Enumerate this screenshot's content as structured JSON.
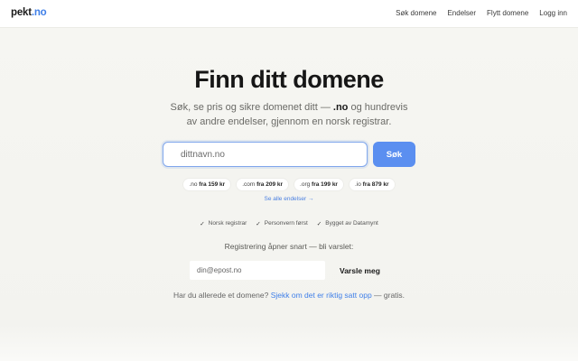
{
  "header": {
    "logo_name": "pekt",
    "logo_tld": ".no",
    "nav": [
      {
        "label": "Søk domene"
      },
      {
        "label": "Endelser"
      },
      {
        "label": "Flytt domene"
      },
      {
        "label": "Logg inn"
      }
    ]
  },
  "hero": {
    "title": "Finn ditt domene",
    "subtitle_line1_before": "Søk, se pris og sikre domenet ditt — ",
    "subtitle_line1_bold": ".no",
    "subtitle_line1_after": " og hundrevis",
    "subtitle_line2": "av andre endelser, gjennom en norsk registrar."
  },
  "search": {
    "placeholder": "dittnavn.no",
    "button_label": "Søk"
  },
  "tld_chips": [
    {
      "tld": ".no",
      "price": "fra 159 kr"
    },
    {
      "tld": ".com",
      "price": "fra 209 kr"
    },
    {
      "tld": ".org",
      "price": "fra 199 kr"
    },
    {
      "tld": ".io",
      "price": "fra 879 kr"
    }
  ],
  "see_all_link": "Se alle endelser →",
  "features": [
    {
      "icon": "check-icon",
      "label": "Norsk registrar"
    },
    {
      "icon": "check-icon",
      "label": "Personvern først"
    },
    {
      "icon": "check-icon",
      "label": "Bygget av Datamynt"
    }
  ],
  "notify": {
    "label": "Registrering åpner snart — bli varslet:",
    "email_placeholder": "din@epost.no",
    "button_label": "Varsle meg"
  },
  "footer_note": {
    "before": "Har du allerede et domene? ",
    "link": "Sjekk om det er riktig satt opp",
    "after": " — gratis."
  },
  "colors": {
    "accent": "#5b8ff0",
    "link": "#3f7fe8",
    "background": "#f4f4f0"
  }
}
